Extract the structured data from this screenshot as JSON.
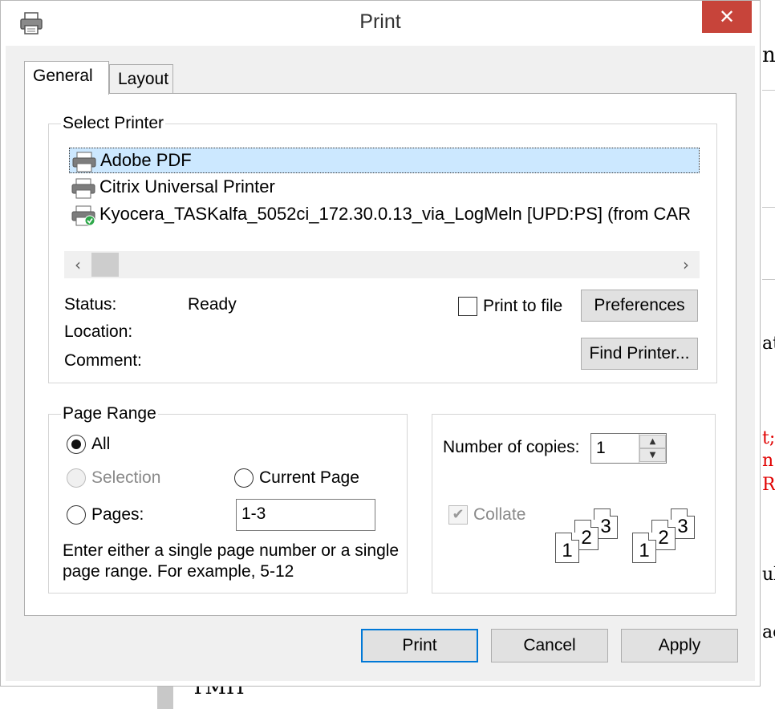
{
  "window": {
    "title": "Print",
    "close_glyph": "✕"
  },
  "tabs": [
    {
      "label": "General"
    },
    {
      "label": "Layout"
    }
  ],
  "select_printer": {
    "legend": "Select Printer",
    "printers": [
      {
        "name": "Adobe PDF",
        "selected": true
      },
      {
        "name": "Citrix Universal Printer",
        "selected": false
      },
      {
        "name": "Kyocera_TASKalfa_5052ci_172.30.0.13_via_LogMeln [UPD:PS] (from CAR",
        "selected": false
      }
    ],
    "scroll_left": "‹",
    "scroll_right": "›",
    "status_label": "Status:",
    "status_value": "Ready",
    "location_label": "Location:",
    "comment_label": "Comment:",
    "print_to_file_label": "Print to file",
    "preferences_label": "Preferences",
    "find_printer_label": "Find Printer..."
  },
  "page_range": {
    "legend": "Page Range",
    "all_label": "All",
    "selection_label": "Selection",
    "current_page_label": "Current Page",
    "pages_label": "Pages:",
    "pages_value": "1-3",
    "help_text_line1": "Enter either a single page number or a single",
    "help_text_line2": "page range.  For example, 5-12"
  },
  "copies": {
    "label": "Number of copies:",
    "value": "1",
    "collate_label": "Collate",
    "collate_checked": true,
    "page_numbers": [
      "1",
      "2",
      "3"
    ]
  },
  "footer": {
    "print_label": "Print",
    "cancel_label": "Cancel",
    "apply_label": "Apply"
  },
  "background": {
    "snippets": [
      "n",
      "ati",
      "t;",
      "n",
      "R",
      "ul",
      "ac",
      "TMH"
    ],
    "accent_red": "#e00000"
  },
  "colors": {
    "close_button": "#c7443a",
    "selection": "#cce8ff",
    "default_button_border": "#0078d7"
  }
}
